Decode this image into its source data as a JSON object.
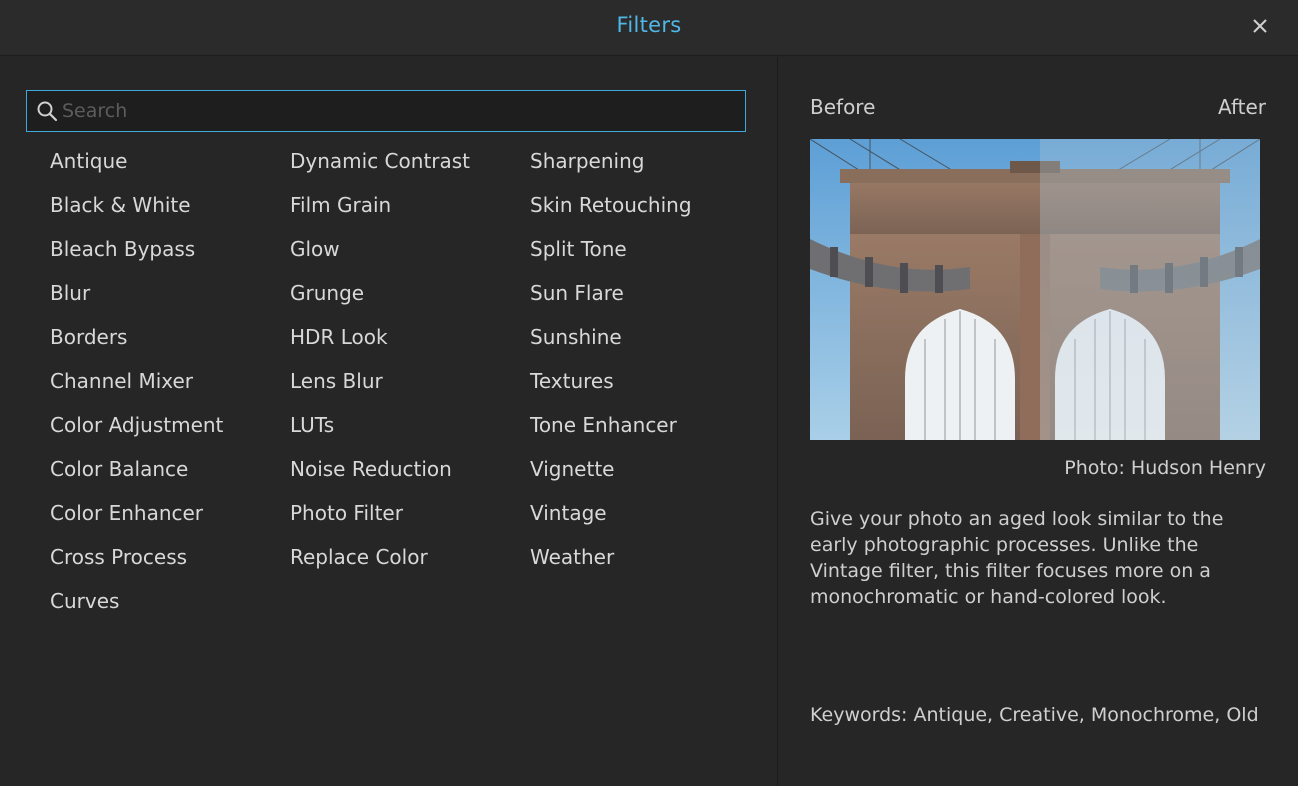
{
  "window": {
    "title": "Filters",
    "close_icon": "close-icon"
  },
  "search": {
    "placeholder": "Search",
    "value": "",
    "icon": "search-icon",
    "accent": "#3fa9d9"
  },
  "filters": {
    "column1": [
      "Antique",
      "Black & White",
      "Bleach Bypass",
      "Blur",
      "Borders",
      "Channel Mixer",
      "Color Adjustment",
      "Color Balance",
      "Color Enhancer",
      "Cross Process",
      "Curves"
    ],
    "column2": [
      "Dynamic Contrast",
      "Film Grain",
      "Glow",
      "Grunge",
      "HDR Look",
      "Lens Blur",
      "LUTs",
      "Noise Reduction",
      "Photo Filter",
      "Replace Color"
    ],
    "column3": [
      "Sharpening",
      "Skin Retouching",
      "Split Tone",
      "Sun Flare",
      "Sunshine",
      "Textures",
      "Tone Enhancer",
      "Vignette",
      "Vintage",
      "Weather"
    ]
  },
  "preview": {
    "before_label": "Before",
    "after_label": "After",
    "credit": "Photo: Hudson Henry",
    "description": "Give your photo an aged look similar to the early photographic processes. Unlike the Vintage filter, this filter focuses more on a monochromatic or hand-colored look.",
    "keywords": "Keywords: Antique, Creative, Monochrome, Old"
  },
  "colors": {
    "accent": "#4fb8e6",
    "background": "#262626",
    "titlebar": "#2b2b2b",
    "text": "#d8d8d8"
  }
}
